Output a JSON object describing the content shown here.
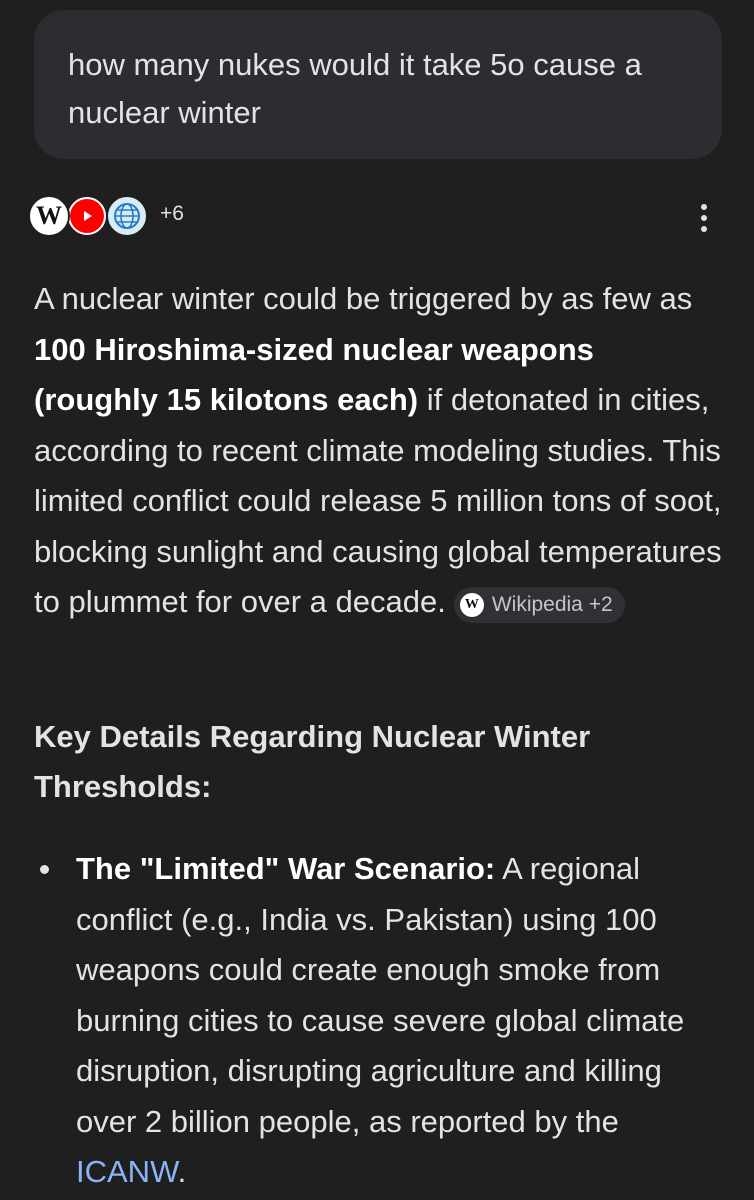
{
  "query": {
    "text": "how many nukes would it take 5o cause a nuclear winter"
  },
  "sources": {
    "icons": [
      "wikipedia-icon",
      "youtube-icon",
      "globe-icon"
    ],
    "wiki_letter": "W",
    "more_count": "+6"
  },
  "answer": {
    "part1": "A nuclear winter could be triggered by as few as ",
    "bold": "100 Hiroshima-sized nuclear weapons (roughly 15 kilotons each)",
    "part2": " if detonated in cities, according to recent climate modeling studies. This limited conflict could release 5 million tons of soot, blocking sunlight and causing global temperatures to plummet for over a decade.",
    "citation": {
      "icon_letter": "W",
      "label": "Wikipedia +2"
    }
  },
  "section": {
    "heading": "Key Details Regarding Nuclear Winter Thresholds:"
  },
  "bullets": [
    {
      "title": "The \"Limited\" War Scenario:",
      "text": " A regional conflict (e.g., India vs. Pakistan) using 100 weapons could create enough smoke from burning cities to cause severe global climate disruption, disrupting agriculture and killing over 2 billion people, as reported by the ",
      "link": "ICANW",
      "tail": "."
    }
  ],
  "colors": {
    "background": "#1f1f1f",
    "bubble": "#2c2d31",
    "text": "#e3e3e3",
    "link": "#8ab4f8",
    "chip": "#303134"
  }
}
